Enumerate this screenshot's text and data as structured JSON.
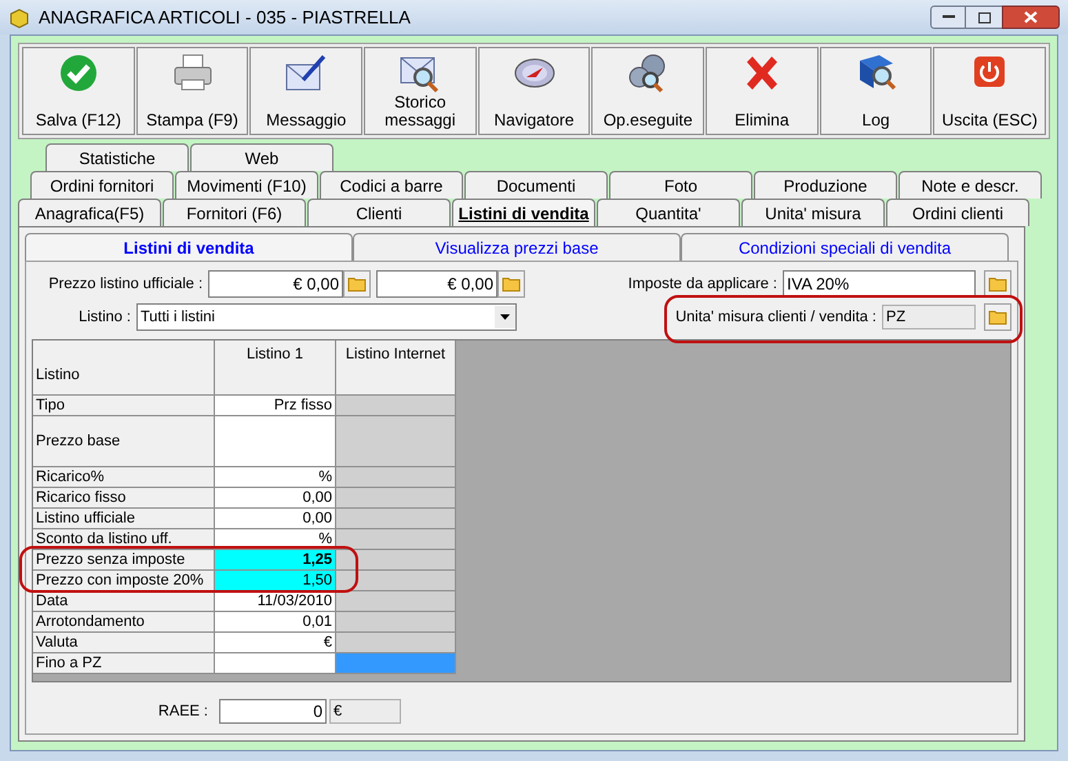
{
  "window": {
    "title": "ANAGRAFICA ARTICOLI - 035 - PIASTRELLA"
  },
  "toolbar": [
    {
      "label": "Salva (F12)",
      "kind": "check"
    },
    {
      "label": "Stampa (F9)",
      "kind": "printer"
    },
    {
      "label": "Messaggio",
      "kind": "mail"
    },
    {
      "label": "Storico messaggi",
      "kind": "mailsearch"
    },
    {
      "label": "Navigatore",
      "kind": "compass"
    },
    {
      "label": "Op.eseguite",
      "kind": "gears"
    },
    {
      "label": "Elimina",
      "kind": "delete"
    },
    {
      "label": "Log",
      "kind": "book"
    },
    {
      "label": "Uscita (ESC)",
      "kind": "power"
    }
  ],
  "tab_rows": [
    [
      {
        "label": "Statistiche",
        "selected": false
      },
      {
        "label": "Web",
        "selected": false
      }
    ],
    [
      {
        "label": "Ordini fornitori",
        "selected": false
      },
      {
        "label": "Movimenti (F10)",
        "selected": false
      },
      {
        "label": "Codici a barre",
        "selected": false
      },
      {
        "label": "Documenti",
        "selected": false
      },
      {
        "label": "Foto",
        "selected": false
      },
      {
        "label": "Produzione",
        "selected": false
      },
      {
        "label": "Note e descr.",
        "selected": false
      }
    ],
    [
      {
        "label": "Anagrafica(F5)",
        "selected": false
      },
      {
        "label": "Fornitori (F6)",
        "selected": false
      },
      {
        "label": "Clienti",
        "selected": false
      },
      {
        "label": "Listini di vendita",
        "selected": true
      },
      {
        "label": "Quantita'",
        "selected": false
      },
      {
        "label": "Unita' misura",
        "selected": false
      },
      {
        "label": "Ordini clienti",
        "selected": false
      }
    ]
  ],
  "sub_tabs": [
    {
      "label": "Listini di vendita",
      "selected": true
    },
    {
      "label": "Visualizza prezzi base",
      "selected": false
    },
    {
      "label": "Condizioni speciali di vendita",
      "selected": false
    }
  ],
  "prezzo_listino_ufficiale": {
    "label": "Prezzo listino ufficiale :",
    "value_1": "€ 0,00",
    "value_2": "€ 0,00"
  },
  "listino": {
    "label": "Listino :",
    "value": "Tutti i listini"
  },
  "imposte": {
    "label": "Imposte da applicare :",
    "value": "IVA 20%"
  },
  "unita_misura": {
    "label": "Unita' misura clienti / vendita :",
    "value": "PZ"
  },
  "table": {
    "columns": [
      "Listino",
      "Listino 1",
      "Listino Internet"
    ],
    "rows": [
      {
        "label": "Tipo",
        "listino_1": "Prz fisso",
        "tall": false,
        "highlighted": false,
        "bold": false,
        "internet_selected": false
      },
      {
        "label": "Prezzo base",
        "tall": true,
        "highlighted": false,
        "bold": false,
        "internet_selected": false
      },
      {
        "label": "Ricarico%",
        "listino_1": "%",
        "tall": false,
        "highlighted": false,
        "bold": false,
        "internet_selected": false
      },
      {
        "label": "Ricarico fisso",
        "listino_1": "0,00",
        "tall": false,
        "highlighted": false,
        "bold": false,
        "internet_selected": false
      },
      {
        "label": "Listino ufficiale",
        "listino_1": "0,00",
        "tall": false,
        "highlighted": false,
        "bold": false,
        "internet_selected": false
      },
      {
        "label": "Sconto da listino uff.",
        "listino_1": "%",
        "tall": false,
        "highlighted": false,
        "bold": false,
        "internet_selected": false
      },
      {
        "label": "Prezzo senza imposte",
        "listino_1": "1,25",
        "tall": false,
        "highlighted": true,
        "bold": true,
        "internet_selected": false
      },
      {
        "label": "Prezzo con imposte 20%",
        "listino_1": "1,50",
        "tall": false,
        "highlighted": true,
        "bold": false,
        "internet_selected": false
      },
      {
        "label": "Data",
        "listino_1": "11/03/2010",
        "tall": false,
        "highlighted": false,
        "bold": false,
        "internet_selected": false
      },
      {
        "label": "Arrotondamento",
        "listino_1": "0,01",
        "tall": false,
        "highlighted": false,
        "bold": false,
        "internet_selected": false
      },
      {
        "label": "Valuta",
        "listino_1": "€",
        "tall": false,
        "highlighted": false,
        "bold": false,
        "internet_selected": false
      },
      {
        "label": "Fino a PZ",
        "tall": false,
        "highlighted": false,
        "bold": false,
        "internet_selected": true
      }
    ]
  },
  "raee": {
    "label": "RAEE :",
    "value": "0",
    "currency": "€"
  }
}
